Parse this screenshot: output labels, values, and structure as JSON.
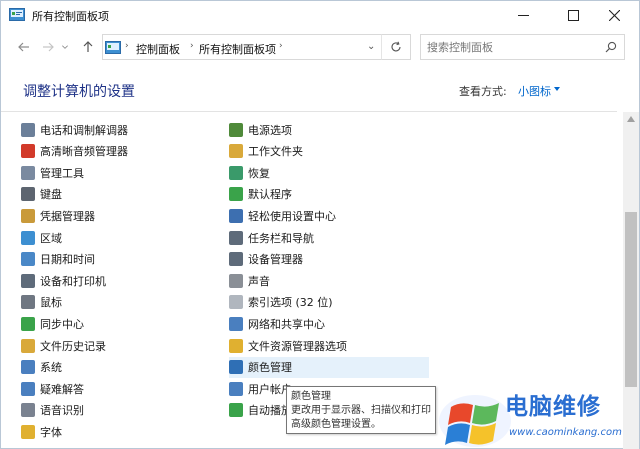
{
  "window": {
    "title": "所有控制面板项"
  },
  "address_bar": {
    "crumbs": [
      "控制面板",
      "所有控制面板项"
    ],
    "search_placeholder": "搜索控制面板"
  },
  "header": {
    "title": "调整计算机的设置",
    "view_by_label": "查看方式:",
    "view_by_value": "小图标"
  },
  "left_items": [
    {
      "label": "电话和调制解调器",
      "icon": "phone-modem-icon",
      "color": "#6b7f99"
    },
    {
      "label": "高清晰音频管理器",
      "icon": "realtek-audio-icon",
      "color": "#d23a2a"
    },
    {
      "label": "管理工具",
      "icon": "admin-tools-icon",
      "color": "#7a8aa0"
    },
    {
      "label": "键盘",
      "icon": "keyboard-icon",
      "color": "#5d6570"
    },
    {
      "label": "凭据管理器",
      "icon": "credential-manager-icon",
      "color": "#c99a3a"
    },
    {
      "label": "区域",
      "icon": "region-icon",
      "color": "#3d8fd1"
    },
    {
      "label": "日期和时间",
      "icon": "date-time-icon",
      "color": "#4a88c7"
    },
    {
      "label": "设备和打印机",
      "icon": "devices-printers-icon",
      "color": "#5e6b7a"
    },
    {
      "label": "鼠标",
      "icon": "mouse-icon",
      "color": "#6f7782"
    },
    {
      "label": "同步中心",
      "icon": "sync-center-icon",
      "color": "#3aa34a"
    },
    {
      "label": "文件历史记录",
      "icon": "file-history-icon",
      "color": "#d9a93a"
    },
    {
      "label": "系统",
      "icon": "system-icon",
      "color": "#4a7fbf"
    },
    {
      "label": "疑难解答",
      "icon": "troubleshooting-icon",
      "color": "#4a7fbf"
    },
    {
      "label": "语音识别",
      "icon": "speech-recognition-icon",
      "color": "#7a8290"
    },
    {
      "label": "字体",
      "icon": "fonts-icon",
      "color": "#e0b030"
    }
  ],
  "right_items": [
    {
      "label": "电源选项",
      "icon": "power-options-icon",
      "color": "#4f8a3a"
    },
    {
      "label": "工作文件夹",
      "icon": "work-folders-icon",
      "color": "#d9a93a"
    },
    {
      "label": "恢复",
      "icon": "recovery-icon",
      "color": "#3a9a6a"
    },
    {
      "label": "默认程序",
      "icon": "default-programs-icon",
      "color": "#3aa34a"
    },
    {
      "label": "轻松使用设置中心",
      "icon": "ease-of-access-icon",
      "color": "#3d6fb0"
    },
    {
      "label": "任务栏和导航",
      "icon": "taskbar-navigation-icon",
      "color": "#5e6b7a"
    },
    {
      "label": "设备管理器",
      "icon": "device-manager-icon",
      "color": "#5e6b7a"
    },
    {
      "label": "声音",
      "icon": "sound-icon",
      "color": "#8a8f96"
    },
    {
      "label": "索引选项 (32 位)",
      "icon": "indexing-options-icon",
      "color": "#b0b6be"
    },
    {
      "label": "网络和共享中心",
      "icon": "network-sharing-icon",
      "color": "#4a7fbf"
    },
    {
      "label": "文件资源管理器选项",
      "icon": "file-explorer-options-icon",
      "color": "#e0b030"
    },
    {
      "label": "颜色管理",
      "icon": "color-management-icon",
      "color": "#2f6fb5"
    },
    {
      "label": "用户帐户",
      "icon": "user-accounts-icon",
      "color": "#4a7fbf"
    },
    {
      "label": "自动播放",
      "icon": "autoplay-icon",
      "color": "#3aa34a"
    }
  ],
  "tooltip": {
    "title": "颜色管理",
    "line1": "更改用于显示器、扫描仪和打印",
    "line2": "高级颜色管理设置。"
  },
  "watermark": {
    "text": "电脑维修",
    "url": "www.caominkang.com"
  }
}
